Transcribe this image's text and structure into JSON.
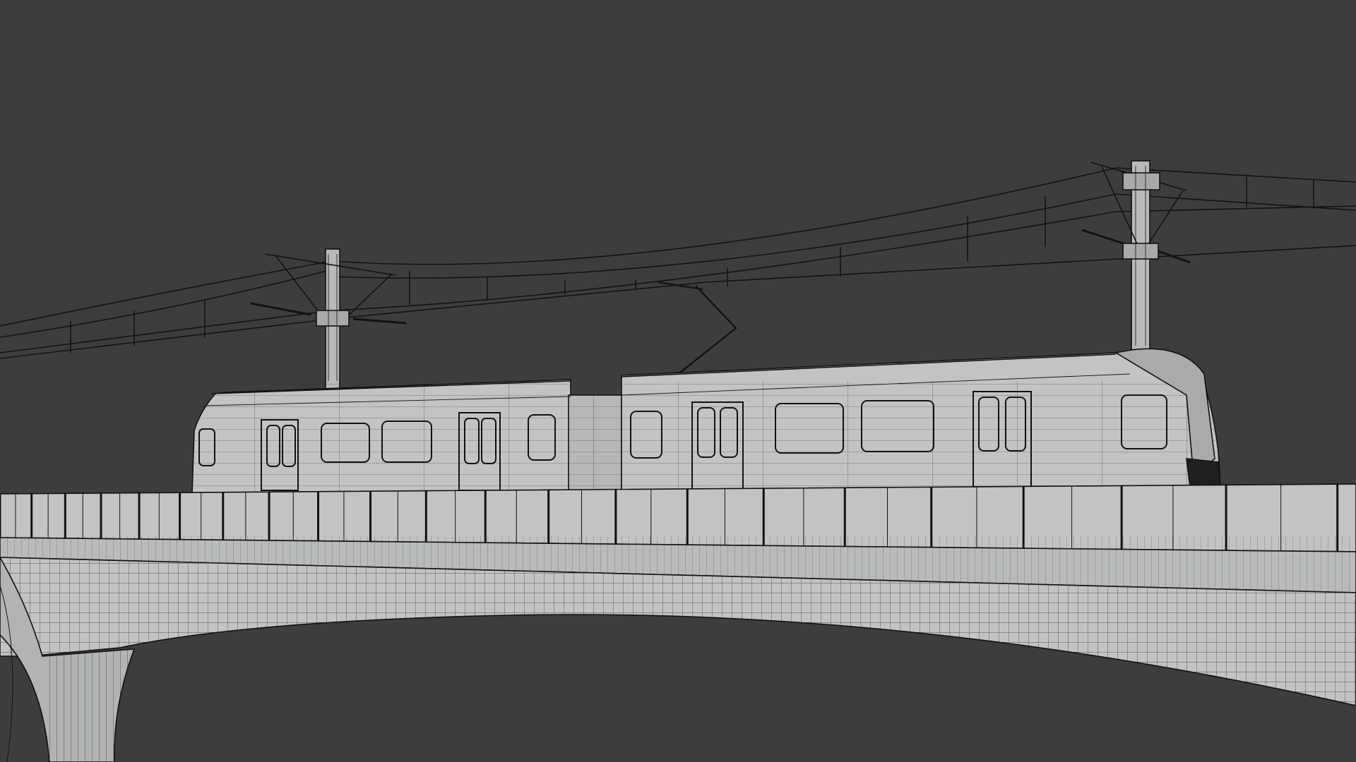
{
  "scene": {
    "kind": "wireframe-render",
    "subject": "light-rail-train-on-elevated-viaduct",
    "background_color": "#3d3d3d",
    "surface_color": "#c2c4c4",
    "wire_color": "#1a1a1a",
    "objects": [
      "train",
      "viaduct",
      "catenary-mast-left",
      "catenary-mast-right",
      "overhead-wires",
      "pantograph"
    ]
  }
}
